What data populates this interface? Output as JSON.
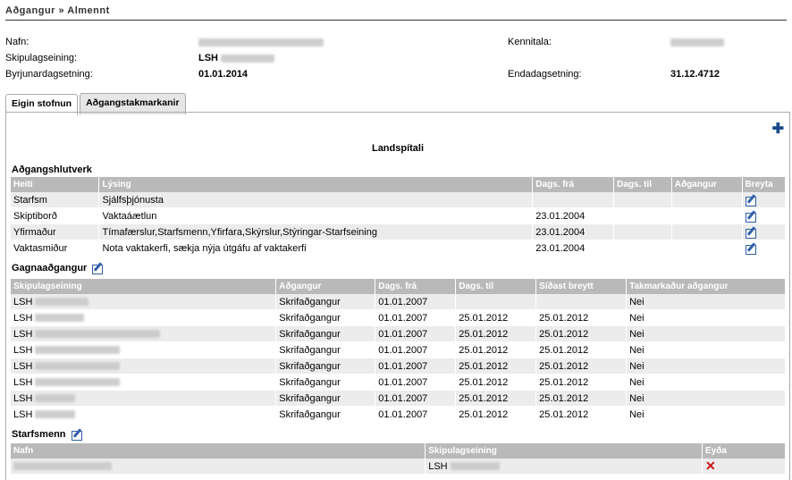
{
  "breadcrumb": "Aðgangur » Almennt",
  "info": {
    "nafn_label": "Nafn:",
    "skipulag_label": "Skipulagseining:",
    "skipulag_value": "LSH",
    "byrjun_label": "Byrjunardagsetning:",
    "byrjun_value": "01.01.2014",
    "kennitala_label": "Kennitala:",
    "enda_label": "Endadagsetning:",
    "enda_value": "31.12.4712"
  },
  "tabs": [
    {
      "label": "Eigin stofnun"
    },
    {
      "label": "Aðgangstakmarkanir"
    }
  ],
  "org_title": "Landspítali",
  "hlutverk": {
    "title": "Aðgangshlutverk",
    "headers": [
      "Heiti",
      "Lýsing",
      "Dags. frá",
      "Dags. til",
      "Aðgangur",
      "Breyta"
    ],
    "rows": [
      {
        "heiti": "Starfsm",
        "lysing": "Sjálfsþjónusta",
        "fra": "",
        "til": "",
        "adgangur": ""
      },
      {
        "heiti": "Skiptiborð",
        "lysing": "Vaktaáætlun",
        "fra": "23.01.2004",
        "til": "",
        "adgangur": ""
      },
      {
        "heiti": "Yfirmaður",
        "lysing": "Tímafærslur,Starfsmenn,Yfirfara,Skýrslur,Stýringar-Starfseining",
        "fra": "23.01.2004",
        "til": "",
        "adgangur": ""
      },
      {
        "heiti": "Vaktasmiður",
        "lysing": "Nota vaktakerfi, sækja nýja útgáfu af vaktakerfi",
        "fra": "23.01.2004",
        "til": "",
        "adgangur": ""
      }
    ]
  },
  "gagna": {
    "title": "Gagnaaðgangur",
    "headers": [
      "Skipulagseining",
      "Aðgangur",
      "Dags. frá",
      "Dags. til",
      "Síðast breytt",
      "Takmarkaður aðgangur"
    ],
    "rows": [
      {
        "eining": "LSH",
        "adgangur": "Skrifaðgangur",
        "fra": "01.01.2007",
        "til": "",
        "breytt": "",
        "takm": "Nei"
      },
      {
        "eining": "LSH",
        "adgangur": "Skrifaðgangur",
        "fra": "01.01.2007",
        "til": "25.01.2012",
        "breytt": "25.01.2012",
        "takm": "Nei"
      },
      {
        "eining": "LSH",
        "adgangur": "Skrifaðgangur",
        "fra": "01.01.2007",
        "til": "25.01.2012",
        "breytt": "25.01.2012",
        "takm": "Nei"
      },
      {
        "eining": "LSH",
        "adgangur": "Skrifaðgangur",
        "fra": "01.01.2007",
        "til": "25.01.2012",
        "breytt": "25.01.2012",
        "takm": "Nei"
      },
      {
        "eining": "LSH",
        "adgangur": "Skrifaðgangur",
        "fra": "01.01.2007",
        "til": "25.01.2012",
        "breytt": "25.01.2012",
        "takm": "Nei"
      },
      {
        "eining": "LSH",
        "adgangur": "Skrifaðgangur",
        "fra": "01.01.2007",
        "til": "25.01.2012",
        "breytt": "25.01.2012",
        "takm": "Nei"
      },
      {
        "eining": "LSH",
        "adgangur": "Skrifaðgangur",
        "fra": "01.01.2007",
        "til": "25.01.2012",
        "breytt": "25.01.2012",
        "takm": "Nei"
      },
      {
        "eining": "LSH",
        "adgangur": "Skrifaðgangur",
        "fra": "01.01.2007",
        "til": "25.01.2012",
        "breytt": "25.01.2012",
        "takm": "Nei"
      }
    ]
  },
  "starfsmenn": {
    "title": "Starfsmenn",
    "headers": [
      "Nafn",
      "Skipulagseining",
      "Eyða"
    ],
    "rows": [
      {
        "eining": "LSH"
      }
    ]
  },
  "icons": {
    "add": "plus-icon",
    "edit": "edit-icon",
    "delete": "delete-icon"
  },
  "colors": {
    "header_bg": "#b9b9b9",
    "row_alt": "#ececec",
    "add_blue": "#1b4a8c",
    "delete_red": "#cc1111"
  }
}
